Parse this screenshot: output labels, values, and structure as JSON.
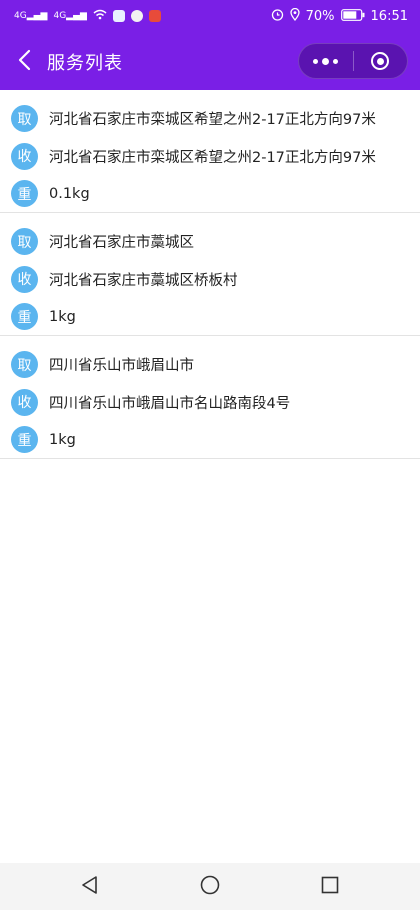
{
  "status_bar": {
    "signal1": "4G",
    "signal2": "4G",
    "battery": "70%",
    "time": "16:51"
  },
  "header": {
    "title": "服务列表"
  },
  "services": [
    {
      "pickup": "河北省石家庄市栾城区希望之州2-17正北方向97米",
      "receive": "河北省石家庄市栾城区希望之州2-17正北方向97米",
      "weight": "0.1kg"
    },
    {
      "pickup": "河北省石家庄市藁城区",
      "receive": "河北省石家庄市藁城区桥板村",
      "weight": "1kg"
    },
    {
      "pickup": "四川省乐山市峨眉山市",
      "receive": "四川省乐山市峨眉山市名山路南段4号",
      "weight": "1kg"
    }
  ],
  "badges": {
    "pickup": "取",
    "receive": "收",
    "weight": "重"
  },
  "colors": {
    "accent": "#7a1fe6",
    "badge": "#5bb5ef"
  }
}
